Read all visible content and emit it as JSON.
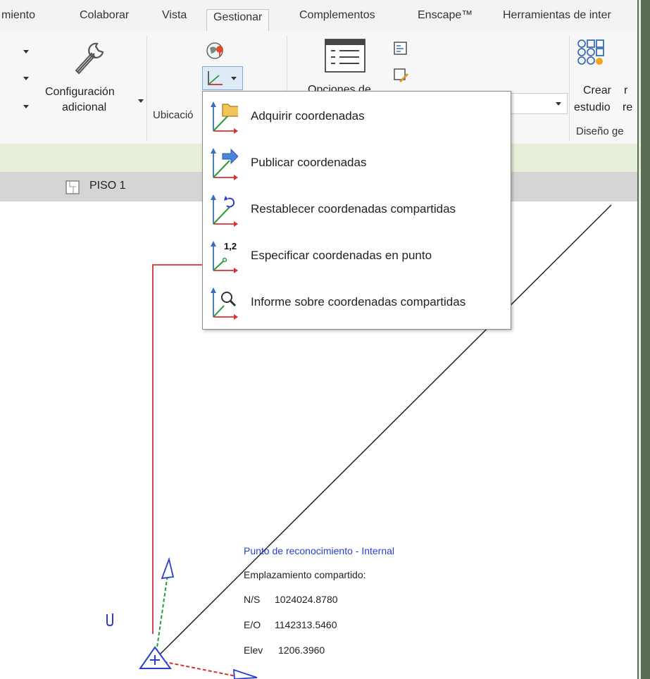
{
  "tabs": [
    "miento",
    "Colaborar",
    "Vista",
    "Gestionar",
    "Complementos",
    "Enscape™",
    "Herramientas de inter"
  ],
  "active_tab": "Gestionar",
  "ribbon": {
    "config_line1": "Configuración",
    "config_line2": "adicional",
    "ubicacion_label": "Ubicació",
    "opciones_partial": "Opciones de",
    "crear": "Crear",
    "estudio": "estudio",
    "r_partial": "r",
    "re_partial": "re",
    "diseno_label": "Diseño ge"
  },
  "view_tab": "PISO 1",
  "menu": {
    "items": [
      {
        "label": "Adquirir coordenadas",
        "icon": "acquire-coordinates-icon"
      },
      {
        "label": "Publicar coordenadas",
        "icon": "publish-coordinates-icon"
      },
      {
        "label": "Restablecer coordenadas compartidas",
        "icon": "reset-coordinates-icon"
      },
      {
        "label": "Especificar coordenadas en punto",
        "icon": "specify-coordinates-icon",
        "badge": "1,2"
      },
      {
        "label": "Informe sobre coordenadas compartidas",
        "icon": "report-coordinates-icon"
      }
    ]
  },
  "survey_point": {
    "title": "Punto de reconocimiento - Internal",
    "subtitle": "Emplazamiento compartido:",
    "ns_label": "N/S",
    "ns_value": "1024024.8780",
    "eo_label": "E/O",
    "eo_value": "1142313.5460",
    "elev_label": "Elev",
    "elev_value": "1206.3960"
  },
  "colors": {
    "accent_blue": "#2a3fd0",
    "axis_red": "#d83030",
    "axis_green": "#2a9a3a",
    "context_green": "#e6efd9"
  }
}
